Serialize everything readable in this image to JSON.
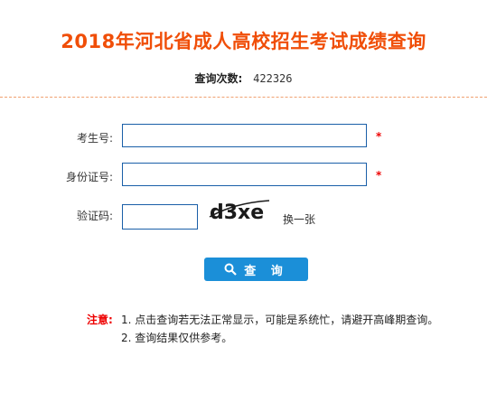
{
  "header": {
    "title": "2018年河北省成人高校招生考试成绩查询"
  },
  "stats": {
    "count_label": "查询次数:",
    "count_value": "422326"
  },
  "form": {
    "exam_no_label": "考生号:",
    "id_no_label": "身份证号:",
    "captcha_label": "验证码:",
    "required_mark": "*",
    "captcha_text": "d3xe",
    "refresh_label": "换一张",
    "submit_label": "查 询"
  },
  "notes": {
    "label": "注意:",
    "items": [
      "1. 点击查询若无法正常显示，可能是系统忙，请避开高峰期查询。",
      "2. 查询结果仅供参考。"
    ]
  },
  "colors": {
    "title": "#f04e08",
    "accent": "#1b8fd8",
    "required": "#ee0000",
    "border": "#1a5fa8"
  }
}
